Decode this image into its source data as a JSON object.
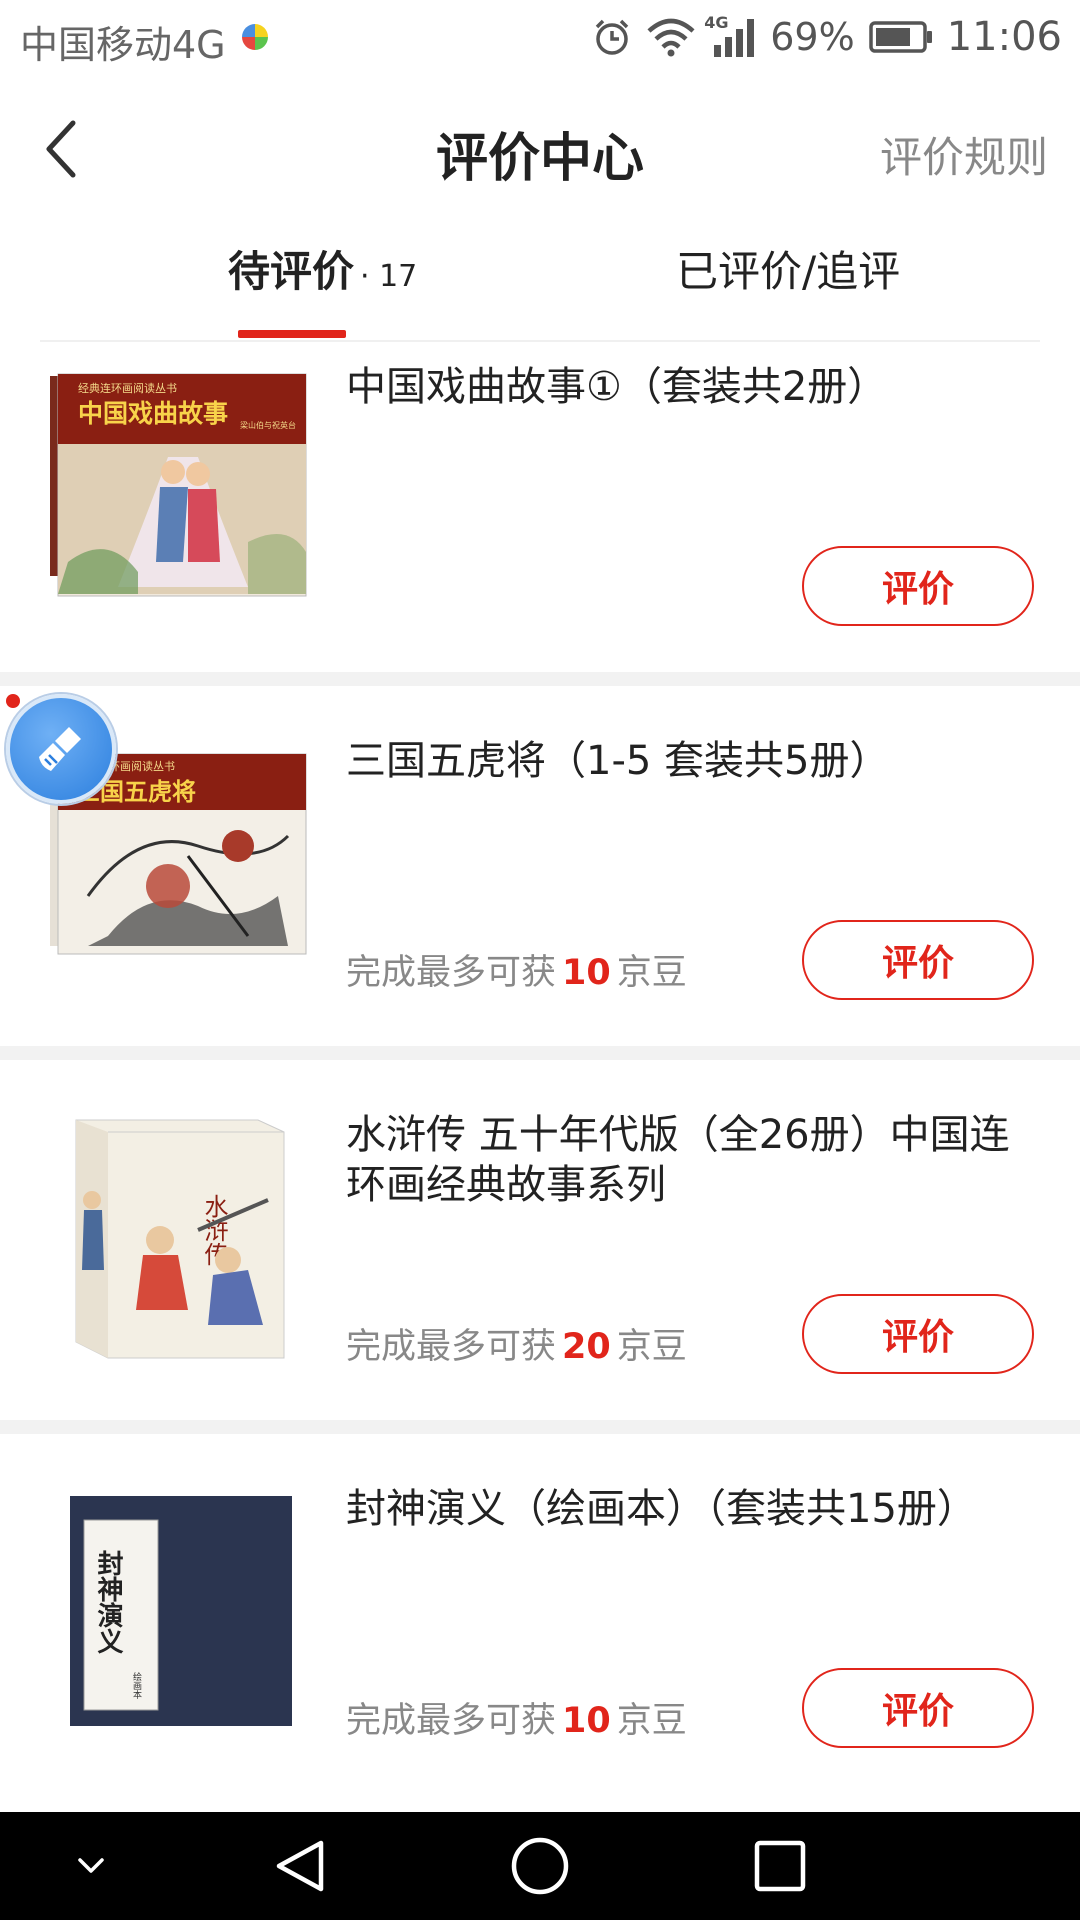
{
  "status_bar": {
    "carrier": "中国移动4G",
    "network_tag": "4G",
    "battery": "69%",
    "time": "11:06"
  },
  "header": {
    "title": "评价中心",
    "rules": "评价规则"
  },
  "tabs": {
    "pending_label": "待评价",
    "pending_count": "· 17",
    "done_label": "已评价/追评"
  },
  "items": [
    {
      "title": "中国戏曲故事①（套装共2册）",
      "cover_series": "经典连环画阅读丛书",
      "cover_title": "中国戏曲故事",
      "cover_sub": "梁山伯与祝英台",
      "button": "评价"
    },
    {
      "title": "三国五虎将（1-5 套装共5册）",
      "cover_series": "经典连环画阅读丛书",
      "cover_title": "三国五虎将",
      "reward_prefix": "完成最多可获",
      "reward_points": "10",
      "reward_suffix": "京豆",
      "button": "评价"
    },
    {
      "title": "水浒传 五十年代版（全26册）中国连环画经典故事系列",
      "cover_title": "水浒传",
      "reward_prefix": "完成最多可获",
      "reward_points": "20",
      "reward_suffix": "京豆",
      "button": "评价"
    },
    {
      "title": "封神演义（绘画本）（套装共15册）",
      "cover_title": "封神演义",
      "cover_sub": "绘画本",
      "reward_prefix": "完成最多可获",
      "reward_points": "10",
      "reward_suffix": "京豆",
      "button": "评价"
    }
  ],
  "colors": {
    "accent": "#e1251b",
    "text_primary": "#222222",
    "text_secondary": "#888888",
    "separator": "#f2f2f2",
    "nav_bar": "#000000"
  },
  "icons": {
    "back": "back-arrow-icon",
    "alarm": "alarm-icon",
    "wifi": "wifi-icon",
    "signal": "signal-icon",
    "battery": "battery-icon",
    "assistant": "broom-icon",
    "nav_collapse": "chevron-down-icon",
    "nav_back": "triangle-back-icon",
    "nav_home": "circle-home-icon",
    "nav_recent": "square-recent-icon"
  }
}
